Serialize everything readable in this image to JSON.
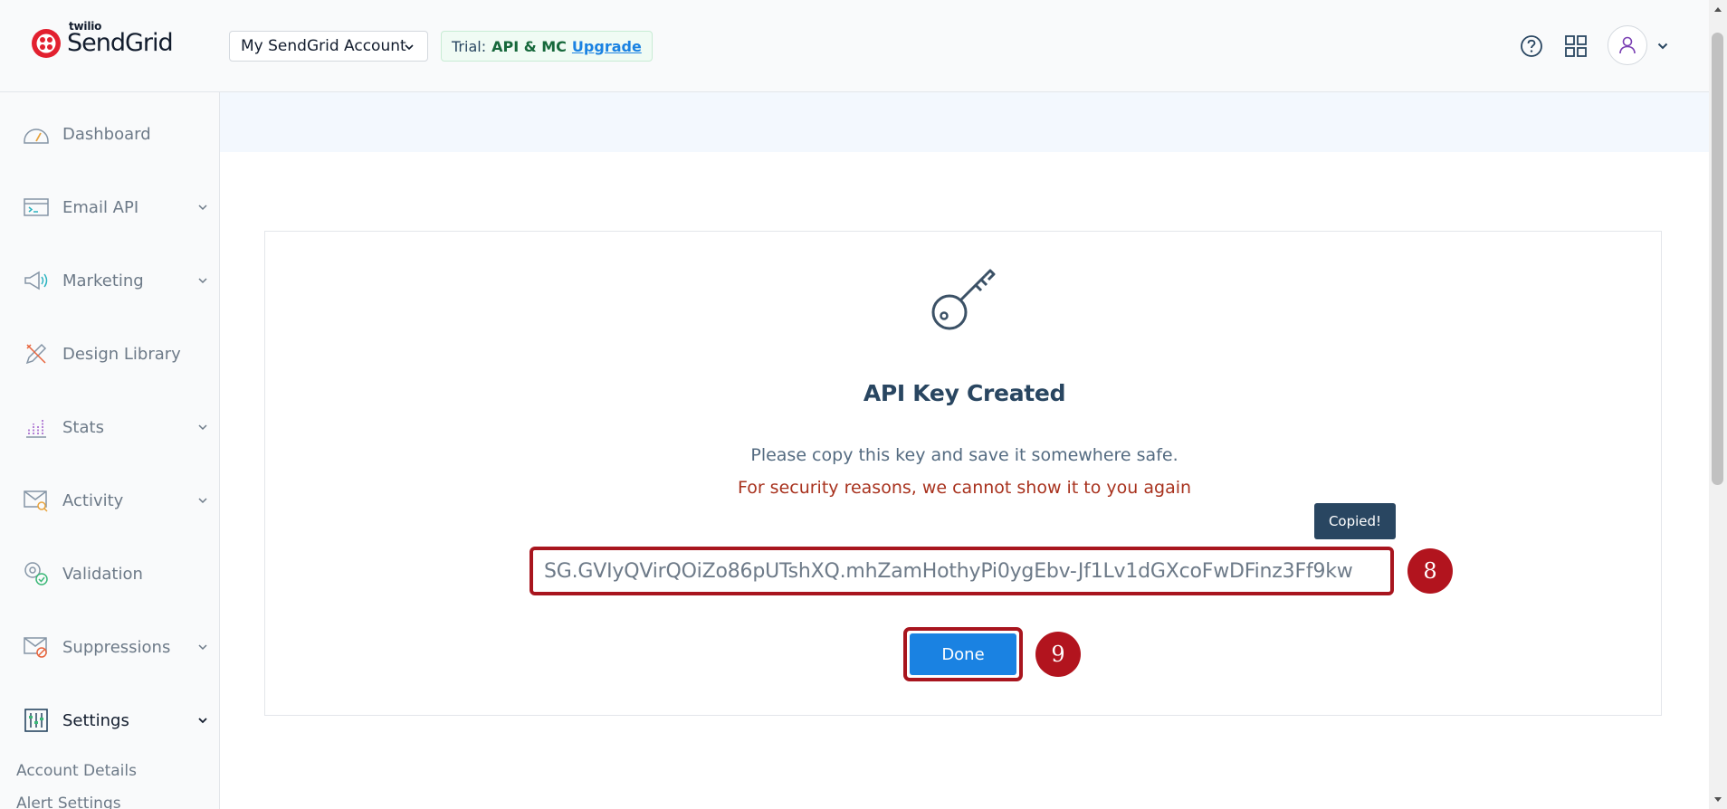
{
  "header": {
    "logo_top": "twilio",
    "logo_main": "SendGrid",
    "account_name": "My SendGrid Account",
    "trial": {
      "label": "Trial:",
      "plan": "API & MC",
      "upgrade": "Upgrade"
    },
    "icons": [
      "help-icon",
      "apps-grid-icon",
      "user-icon",
      "chevron-down-icon"
    ]
  },
  "sidebar": {
    "items": [
      {
        "label": "Dashboard",
        "icon": "dashboard-gauge-icon",
        "expandable": false
      },
      {
        "label": "Email API",
        "icon": "email-api-icon",
        "expandable": true
      },
      {
        "label": "Marketing",
        "icon": "megaphone-icon",
        "expandable": true
      },
      {
        "label": "Design Library",
        "icon": "design-pencil-icon",
        "expandable": false
      },
      {
        "label": "Stats",
        "icon": "stats-chart-icon",
        "expandable": true
      },
      {
        "label": "Activity",
        "icon": "activity-envelope-icon",
        "expandable": true
      },
      {
        "label": "Validation",
        "icon": "validation-at-icon",
        "expandable": false
      },
      {
        "label": "Suppressions",
        "icon": "suppression-envelope-icon",
        "expandable": true
      },
      {
        "label": "Settings",
        "icon": "settings-sliders-icon",
        "expandable": true,
        "active": true
      }
    ],
    "sub_items": [
      "Account Details",
      "Alert Settings"
    ]
  },
  "main": {
    "title": "API Key Created",
    "message": "Please copy this key and save it somewhere safe.",
    "warning": "For security reasons, we cannot show it to you again",
    "tooltip": "Copied!",
    "api_key": "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",
    "done_label": "Done",
    "step_badges": [
      "8",
      "9"
    ]
  },
  "colors": {
    "accent": "#1a82e2",
    "annotation_red": "#b2141e",
    "warning_text": "#a8321e",
    "navy": "#294661"
  }
}
